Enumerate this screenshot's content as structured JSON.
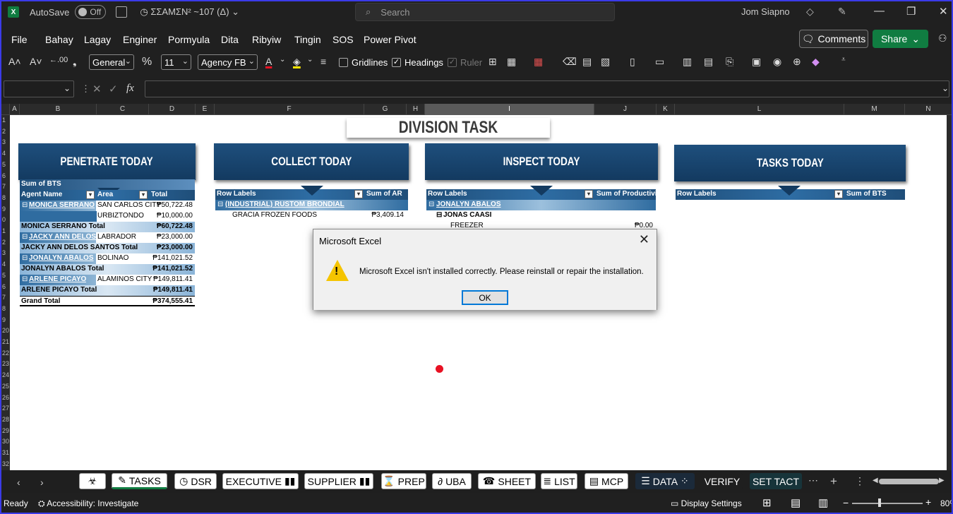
{
  "titlebar": {
    "logo": "X",
    "autosave_label": "AutoSave",
    "autosave_state": "Off",
    "doc_name": "ΣΣΑΜΣΝ² ~107 (Δ)",
    "search_placeholder": "Search",
    "user": "Jom Siapno"
  },
  "menu": [
    "File",
    "Bahay",
    "Lagay",
    "Enginer",
    "Pormyula",
    "Dita",
    "Ribyiw",
    "Tingin",
    "SOS",
    "Power Pivot"
  ],
  "comments_label": "Comments",
  "share_label": "Share",
  "ribbon": {
    "number_format": "General",
    "font_size": "11",
    "font_name": "Agency FB",
    "gridlines_label": "Gridlines",
    "headings_label": "Headings",
    "ruler_label": "Ruler"
  },
  "formula": {
    "fx": "fx"
  },
  "columns": [
    "A",
    "B",
    "C",
    "D",
    "E",
    "F",
    "G",
    "H",
    "I",
    "J",
    "K",
    "L",
    "M",
    "N"
  ],
  "rows": [
    "1",
    "2",
    "3",
    "4",
    "5",
    "6",
    "7",
    "8",
    "9",
    "0",
    "1",
    "2",
    "3",
    "4",
    "5",
    "6",
    "7",
    "8",
    "9",
    "20",
    "21",
    "22",
    "23",
    "24",
    "25",
    "26",
    "27",
    "28",
    "29",
    "30",
    "31",
    "32"
  ],
  "banner": "DIVISION TASK",
  "sections": {
    "penetrate": "PENETRATE TODAY",
    "collect": "COLLECT TODAY",
    "inspect": "INSPECT TODAY",
    "tasks": "TASKS TODAY"
  },
  "pivot_penetrate": {
    "caption": "Sum of BTS",
    "headers": [
      "Agent Name",
      "Area",
      "Total"
    ],
    "rows": [
      {
        "agent": "MONICA SERRANO",
        "area": "SAN CARLOS CITY",
        "total": "₱50,722.48",
        "kind": "group"
      },
      {
        "agent": "",
        "area": "URBIZTONDO",
        "total": "₱10,000.00",
        "kind": "item"
      },
      {
        "agent": "MONICA SERRANO Total",
        "area": "",
        "total": "₱60,722.48",
        "kind": "total"
      },
      {
        "agent": "JACKY ANN DELOS SA",
        "area": "LABRADOR",
        "total": "₱23,000.00",
        "kind": "group"
      },
      {
        "agent": "JACKY ANN DELOS SANTOS Total",
        "area": "",
        "total": "₱23,000.00",
        "kind": "total"
      },
      {
        "agent": "JONALYN ABALOS",
        "area": "BOLINAO",
        "total": "₱141,021.52",
        "kind": "group"
      },
      {
        "agent": "JONALYN ABALOS Total",
        "area": "",
        "total": "₱141,021.52",
        "kind": "total"
      },
      {
        "agent": "ARLENE PICAYO",
        "area": "ALAMINOS CITY",
        "total": "₱149,811.41",
        "kind": "group"
      },
      {
        "agent": "ARLENE PICAYO Total",
        "area": "",
        "total": "₱149,811.41",
        "kind": "total"
      },
      {
        "agent": "Grand Total",
        "area": "",
        "total": "₱374,555.41",
        "kind": "grand"
      }
    ]
  },
  "pivot_collect": {
    "headers": [
      "Row Labels",
      "Sum of AR"
    ],
    "group": "(INDUSTRIAL) RUSTOM BRONDIAL",
    "item": "GRACIA FROZEN FOODS",
    "item_value": "₱3,409.14"
  },
  "pivot_inspect": {
    "headers": [
      "Row Labels",
      "Sum of Productivity"
    ],
    "group": "JONALYN ABALOS",
    "sub": "JONAS CAASI",
    "item": "FREEZER",
    "item_value": "₱0.00"
  },
  "pivot_tasks": {
    "headers": [
      "Row Labels",
      "Sum of BTS"
    ]
  },
  "dialog": {
    "title": "Microsoft Excel",
    "message": "Microsoft Excel isn't installed correctly. Please reinstall or repair the installation.",
    "ok": "OK"
  },
  "tabs": [
    "TASKS",
    "DSR",
    "EXECUTIVE",
    "SUPPLIER",
    "PREP",
    "UBA",
    "SHEET",
    "LIST",
    "MCP",
    "DATA",
    "VERIFY",
    "SET TACT"
  ],
  "status": {
    "ready": "Ready",
    "accessibility": "Accessibility: Investigate",
    "display_settings": "Display Settings",
    "zoom": "80%"
  },
  "colors": {
    "excel_green": "#107c41",
    "header_blue": "#1f4e79",
    "dialog_focus": "#0078d7"
  }
}
